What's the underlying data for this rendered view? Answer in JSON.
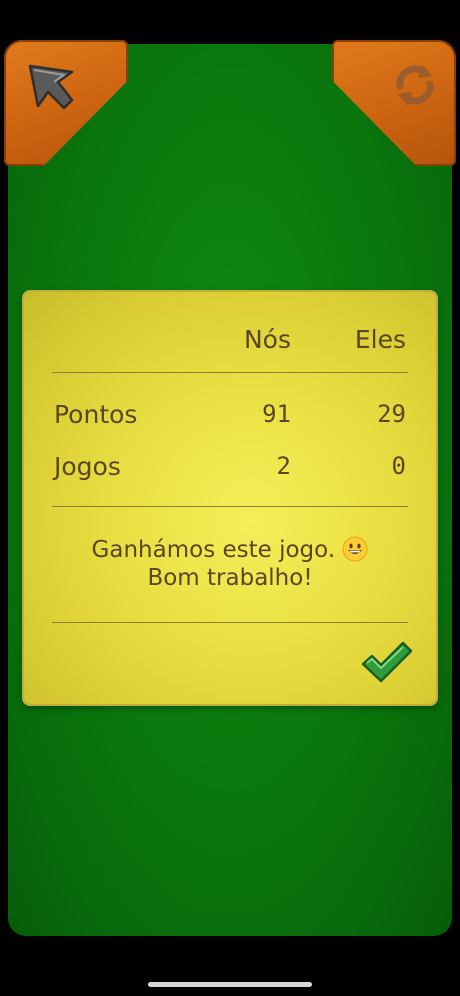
{
  "header": {
    "back_icon": "arrow-up-left-icon",
    "refresh_icon": "refresh-icon"
  },
  "scoreboard": {
    "col_us": "Nós",
    "col_them": "Eles",
    "rows": [
      {
        "label": "Pontos",
        "us": "91",
        "them": "29"
      },
      {
        "label": "Jogos",
        "us": "2",
        "them": "0"
      }
    ],
    "message_line1": "Ganhámos este jogo.",
    "message_line2": "Bom trabalho!",
    "emoji": "grinning-face-icon",
    "confirm_icon": "checkmark-icon"
  },
  "colors": {
    "table_green": "#0b7a0e",
    "card_yellow": "#ece246",
    "corner_orange": "#cc6411",
    "text_brown": "#5a4622",
    "check_green": "#2f9c3a"
  }
}
